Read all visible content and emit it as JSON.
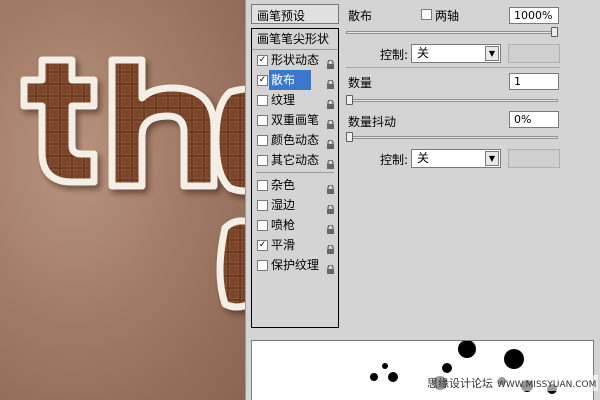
{
  "panel": {
    "presets_label": "画笔预设",
    "tip_shape_label": "画笔笔尖形状",
    "categories": [
      {
        "label": "形状动态",
        "checked": true,
        "selected": false
      },
      {
        "label": "散布",
        "checked": true,
        "selected": true
      },
      {
        "label": "纹理",
        "checked": false,
        "selected": false
      },
      {
        "label": "双重画笔",
        "checked": false,
        "selected": false
      },
      {
        "label": "颜色动态",
        "checked": false,
        "selected": false
      },
      {
        "label": "其它动态",
        "checked": false,
        "selected": false
      },
      {
        "label": "杂色",
        "checked": false,
        "selected": false
      },
      {
        "label": "湿边",
        "checked": false,
        "selected": false
      },
      {
        "label": "喷枪",
        "checked": false,
        "selected": false
      },
      {
        "label": "平滑",
        "checked": true,
        "selected": false
      },
      {
        "label": "保护纹理",
        "checked": false,
        "selected": false
      }
    ],
    "check_mark": "✓",
    "lock_icon": "lock-icon"
  },
  "scatter": {
    "title": "散布",
    "both_axes_label": "两轴",
    "both_axes_checked": false,
    "value": "1000%",
    "slider_fraction": 1.0,
    "control_label": "控制:",
    "control_value": "关"
  },
  "count": {
    "title": "数量",
    "value": "1",
    "slider_fraction": 0.0
  },
  "count_jitter": {
    "title": "数量抖动",
    "value": "0%",
    "slider_fraction": 0.0,
    "control_label": "控制:",
    "control_value": "关"
  },
  "watermark": {
    "text": "思缘设计论坛",
    "site": "WWW.MISSYUAN.COM"
  },
  "colors": {
    "selection": "#3a78cf",
    "panel_bg": "#d4d4d4",
    "chocolate": "#6b3a22"
  }
}
